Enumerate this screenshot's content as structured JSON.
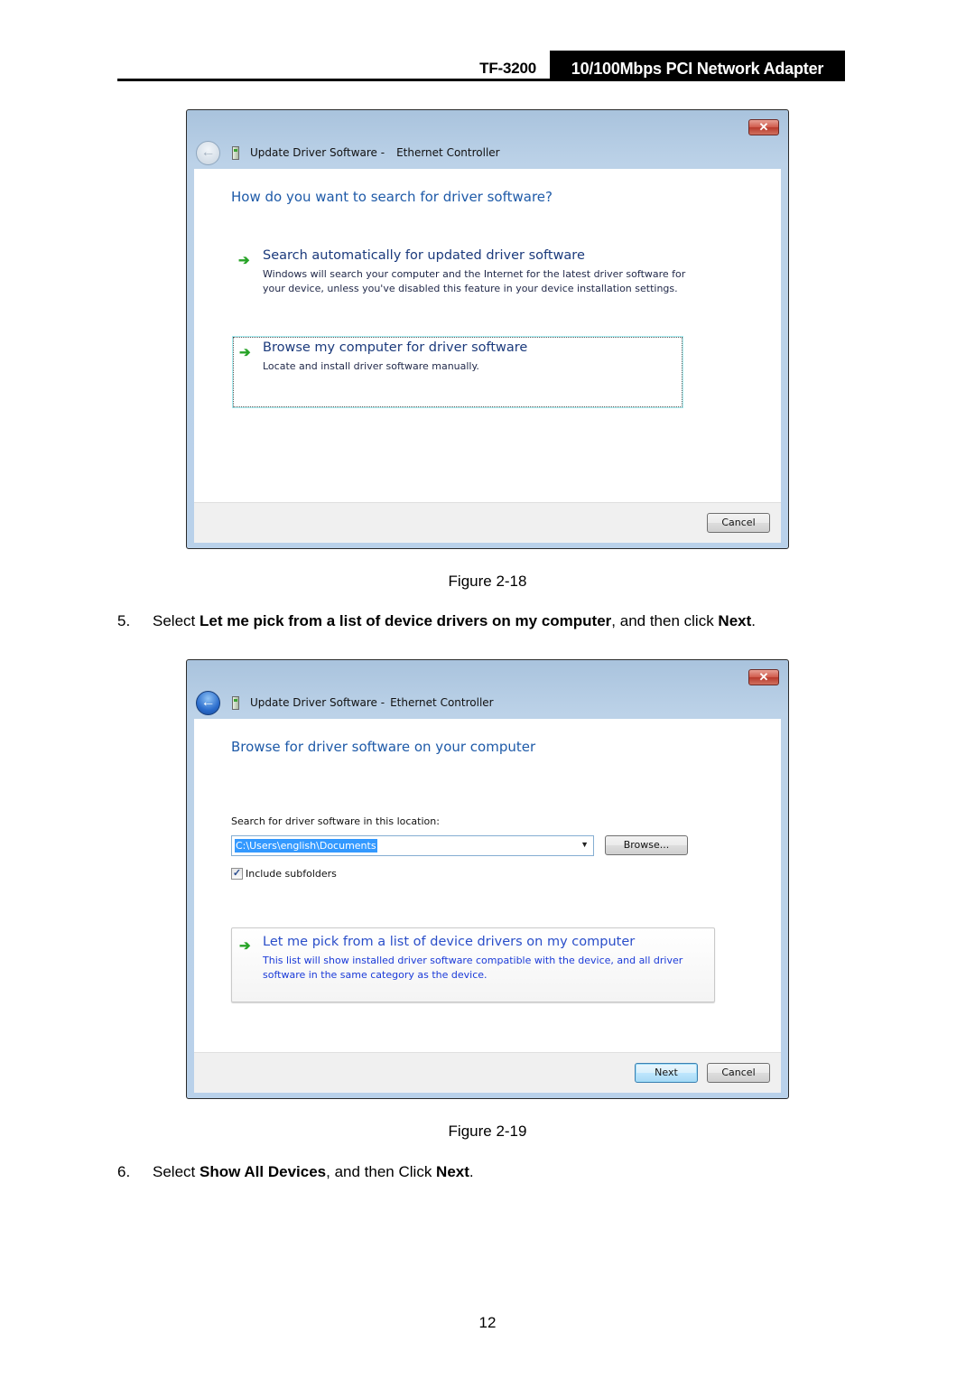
{
  "header": {
    "model": "TF-3200",
    "product": "10/100Mbps PCI Network Adapter"
  },
  "figures": [
    {
      "window": {
        "close_icon": "close-icon",
        "back_icon": "back-arrow-icon",
        "back_enabled": false,
        "title_prefix": "Update Driver Software -",
        "title_device": "Ethernet Controller"
      },
      "heading": "How do you want to search for driver software?",
      "options": [
        {
          "icon": "green-arrow-icon",
          "title": "Search automatically for updated driver software",
          "description": "Windows will search your computer and the Internet for the latest driver software for your device, unless you've disabled this feature in your device installation settings.",
          "focused": false
        },
        {
          "icon": "green-arrow-icon",
          "title": "Browse my computer for driver software",
          "description": "Locate and install driver software manually.",
          "focused": true
        }
      ],
      "buttons": {
        "cancel": "Cancel"
      },
      "caption": "Figure 2-18"
    },
    {
      "window": {
        "close_icon": "close-icon",
        "back_icon": "back-arrow-icon",
        "back_enabled": true,
        "title_prefix": "Update Driver Software -",
        "title_device": "Ethernet Controller"
      },
      "heading": "Browse for driver software on your computer",
      "location_label": "Search for driver software in this location:",
      "location_value": "C:\\Users\\english\\Documents",
      "browse_label": "Browse...",
      "include_subfolders_label": "Include subfolders",
      "include_subfolders_checked": true,
      "pick_option": {
        "icon": "green-arrow-icon",
        "title": "Let me pick from a list of device drivers on my computer",
        "description": "This list will show installed driver software compatible with the device, and all driver software in the same category as the device.",
        "hovered": true
      },
      "buttons": {
        "next": "Next",
        "cancel": "Cancel"
      },
      "caption": "Figure 2-19"
    }
  ],
  "steps": [
    {
      "number": "5.",
      "pre": "Select ",
      "bold1": "Let me pick from a list of device drivers on my computer",
      "mid": ", and then click ",
      "bold2": "Next",
      "post": "."
    },
    {
      "number": "6.",
      "pre": "Select ",
      "bold1": "Show All Devices",
      "mid": ", and then Click ",
      "bold2": "Next",
      "post": "."
    }
  ],
  "page_number": "12"
}
